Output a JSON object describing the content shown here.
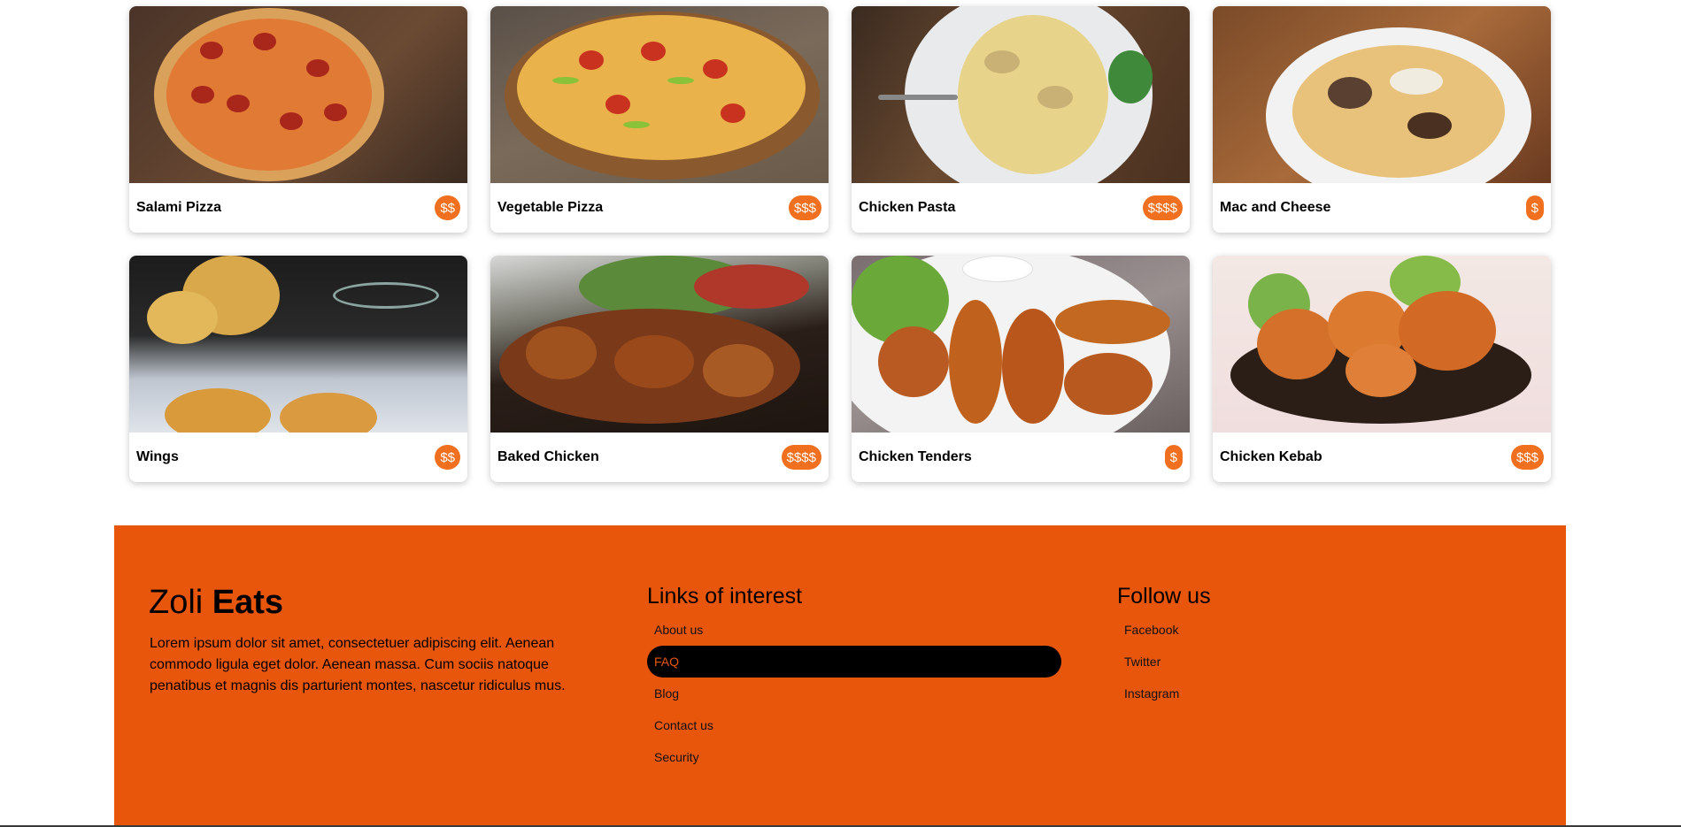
{
  "menu": {
    "items": [
      {
        "name": "Salami Pizza",
        "price": "$$"
      },
      {
        "name": "Vegetable Pizza",
        "price": "$$$"
      },
      {
        "name": "Chicken Pasta",
        "price": "$$$$"
      },
      {
        "name": "Mac and Cheese",
        "price": "$"
      },
      {
        "name": "Wings",
        "price": "$$"
      },
      {
        "name": "Baked Chicken",
        "price": "$$$$"
      },
      {
        "name": "Chicken Tenders",
        "price": "$"
      },
      {
        "name": "Chicken Kebab",
        "price": "$$$"
      }
    ]
  },
  "footer": {
    "brand_light": "Zoli",
    "brand_bold": "Eats",
    "about": "Lorem ipsum dolor sit amet, consectetuer adipiscing elit. Aenean commodo ligula eget dolor. Aenean massa. Cum sociis natoque penatibus et magnis dis parturient montes, nascetur ridiculus mus.",
    "links_title": "Links of interest",
    "links": [
      "About us",
      "FAQ",
      "Blog",
      "Contact us",
      "Security"
    ],
    "follow_title": "Follow us",
    "social": [
      "Facebook",
      "Twitter",
      "Instagram"
    ]
  },
  "colors": {
    "accent": "#e8560c",
    "price_badge": "#f0701f"
  }
}
